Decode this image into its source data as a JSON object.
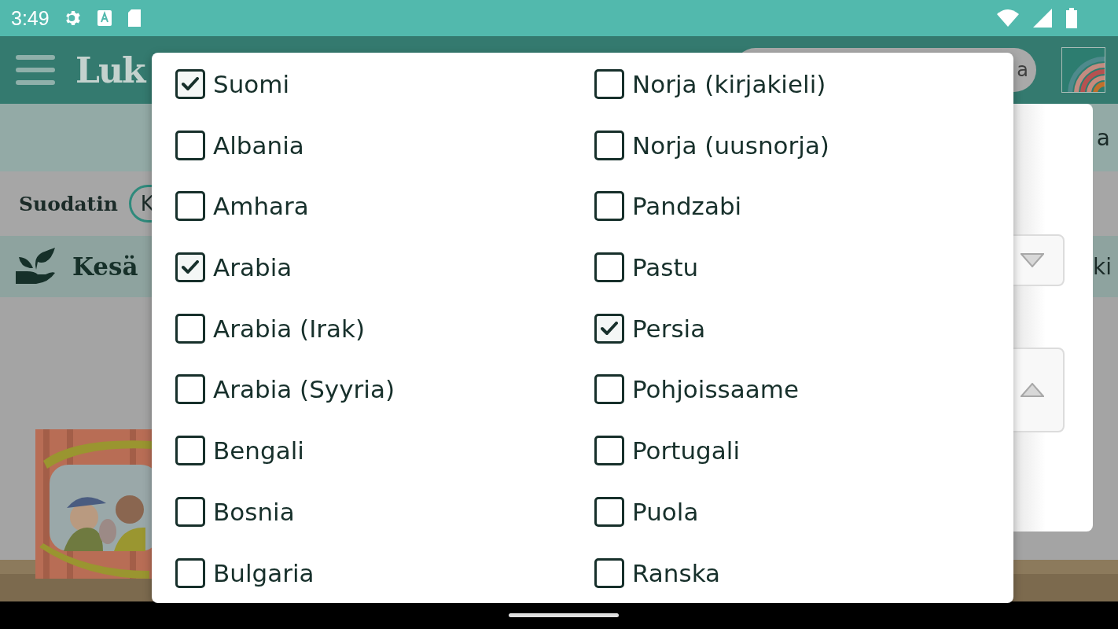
{
  "status_bar": {
    "time": "3:49"
  },
  "app_bar": {
    "logo_text": "Luk",
    "search": {
      "value": "a"
    }
  },
  "info_band": {
    "text": "a"
  },
  "filter": {
    "label": "Suodatin",
    "chip": "K"
  },
  "category": {
    "title": "Kesä",
    "trailing_text": "ki"
  },
  "language_dialog": {
    "columns": [
      {
        "items": [
          {
            "label": "Suomi",
            "checked": true
          },
          {
            "label": "Albania",
            "checked": false
          },
          {
            "label": "Amhara",
            "checked": false
          },
          {
            "label": "Arabia",
            "checked": true
          },
          {
            "label": "Arabia (Irak)",
            "checked": false
          },
          {
            "label": "Arabia (Syyria)",
            "checked": false
          },
          {
            "label": "Bengali",
            "checked": false
          },
          {
            "label": "Bosnia",
            "checked": false
          },
          {
            "label": "Bulgaria",
            "checked": false
          }
        ]
      },
      {
        "items": [
          {
            "label": "Norja (kirjakieli)",
            "checked": false
          },
          {
            "label": "Norja (uusnorja)",
            "checked": false
          },
          {
            "label": "Pandzabi",
            "checked": false
          },
          {
            "label": "Pastu",
            "checked": false
          },
          {
            "label": "Persia",
            "checked": true
          },
          {
            "label": "Pohjoissaame",
            "checked": false
          },
          {
            "label": "Portugali",
            "checked": false
          },
          {
            "label": "Puola",
            "checked": false
          },
          {
            "label": "Ranska",
            "checked": false
          }
        ]
      }
    ]
  }
}
